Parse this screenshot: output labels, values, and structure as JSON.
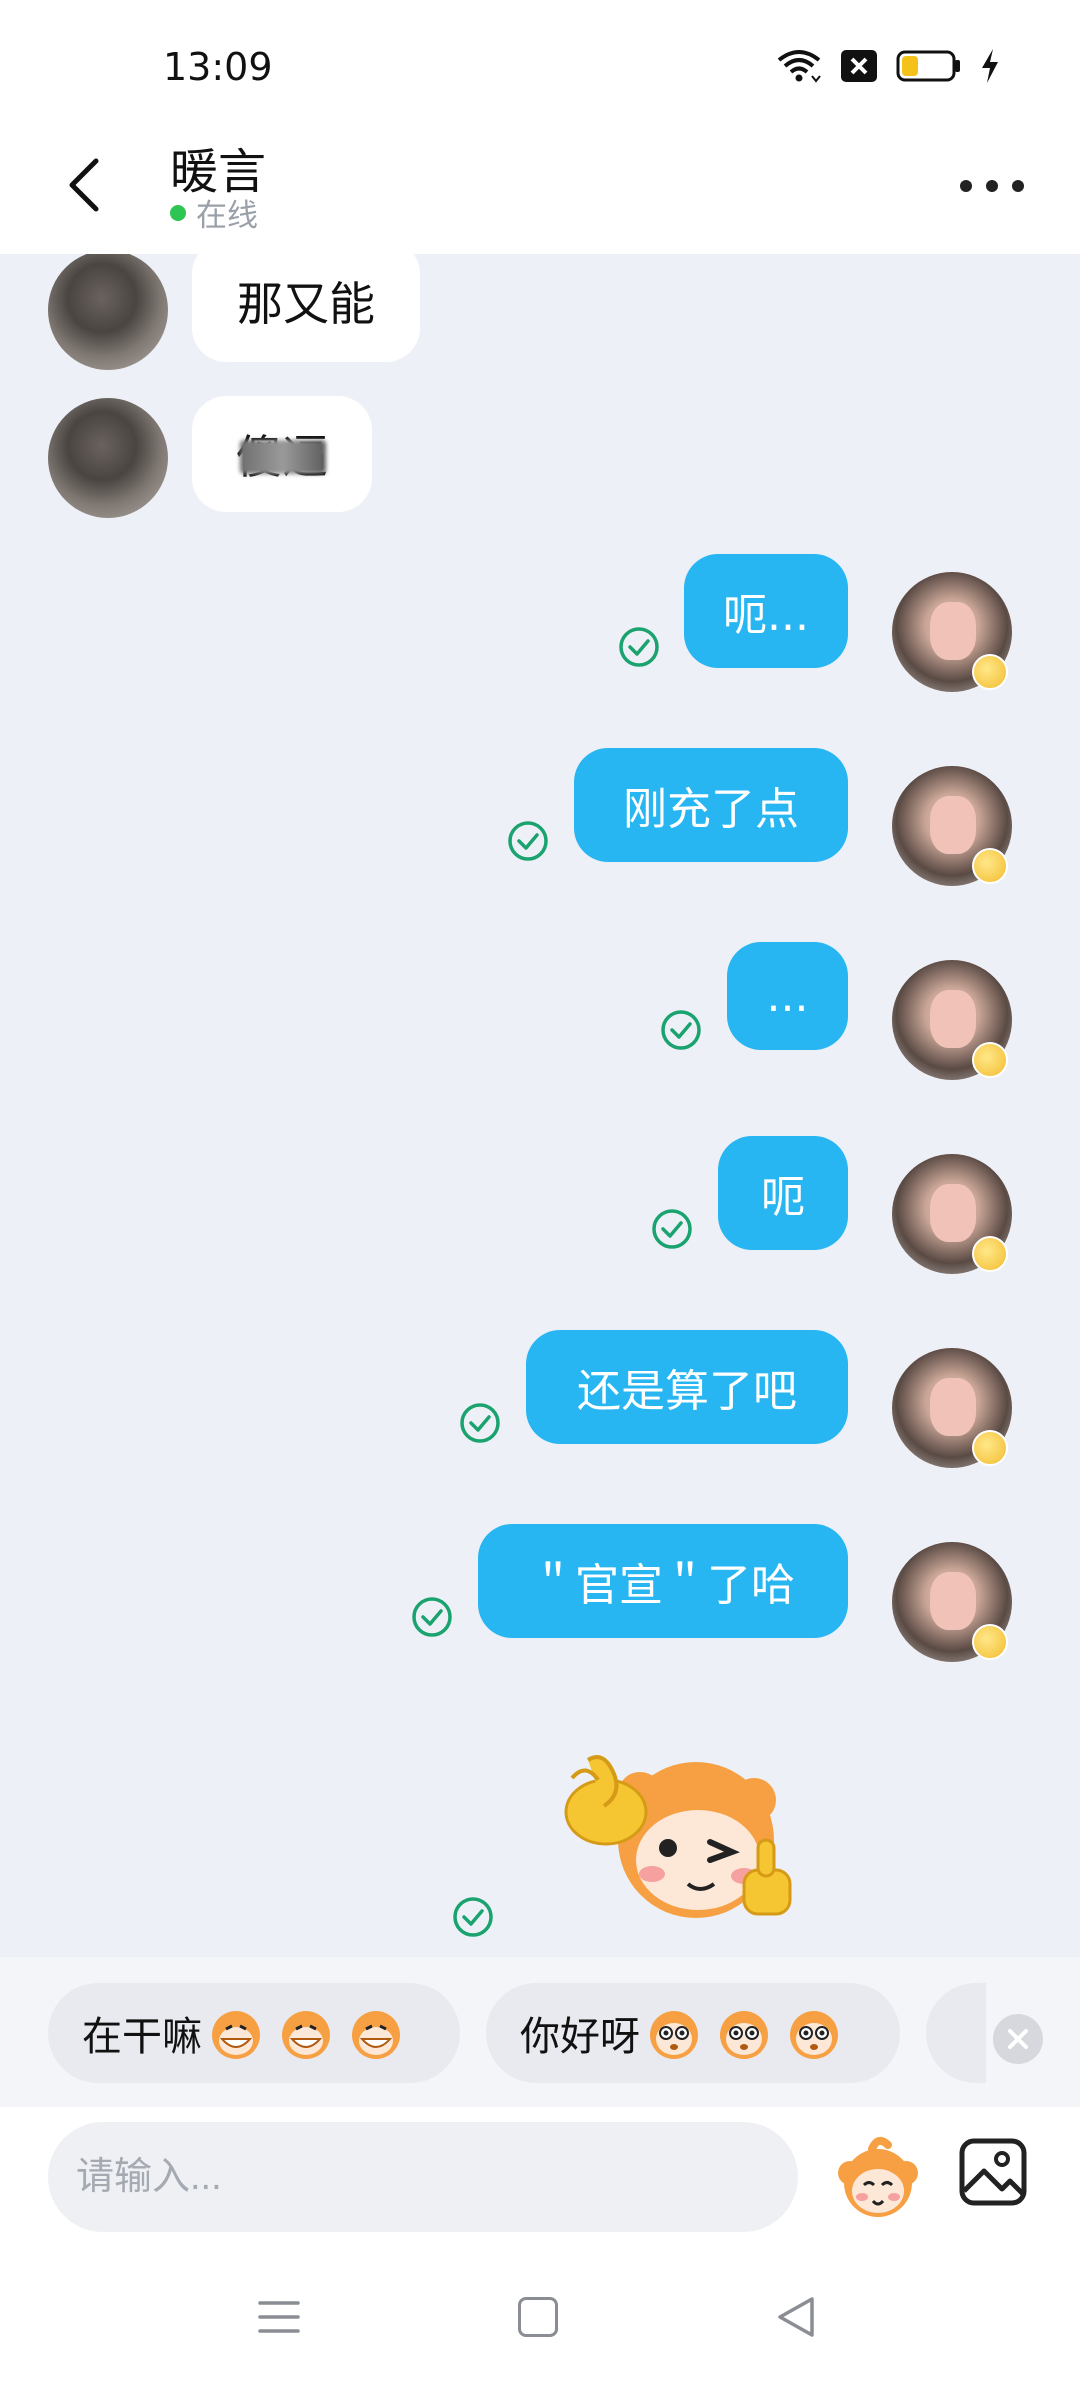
{
  "status_bar": {
    "time": "13:09",
    "icons": [
      "wifi-icon",
      "sim-blocked-icon",
      "battery-low-icon",
      "charging-bolt-icon"
    ],
    "battery_color": "#f4c21b"
  },
  "header": {
    "contact_name": "暖言",
    "presence": "在线",
    "presence_color": "#2dc653"
  },
  "messages": [
    {
      "direction": "in",
      "text": "那又能"
    },
    {
      "direction": "in",
      "text": "傻逼"
    },
    {
      "direction": "out",
      "text": "呃...",
      "read": true
    },
    {
      "direction": "out",
      "text": "刚充了点",
      "read": true
    },
    {
      "direction": "out",
      "text": "...",
      "read": true
    },
    {
      "direction": "out",
      "text": "呃",
      "read": true
    },
    {
      "direction": "out",
      "text": "还是算了吧",
      "read": true
    },
    {
      "direction": "out",
      "text": "＂官宣＂了哈",
      "read": true
    },
    {
      "direction": "out",
      "type": "sticker",
      "sticker": "monkey-ok-thumbs-up",
      "read": true
    }
  ],
  "quick_replies": [
    {
      "text": "在干嘛",
      "emojis": [
        "grin-monkey-icon",
        "grin-monkey-icon",
        "grin-monkey-icon"
      ]
    },
    {
      "text": "你好呀",
      "emojis": [
        "surprised-monkey-icon",
        "surprised-monkey-icon",
        "surprised-monkey-icon"
      ]
    }
  ],
  "input": {
    "placeholder": "请输入..."
  },
  "colors": {
    "outgoing_bubble": "#27b6f2",
    "incoming_bubble": "#ffffff",
    "chat_background": "#eef0f7",
    "read_check": "#1aa36f"
  }
}
